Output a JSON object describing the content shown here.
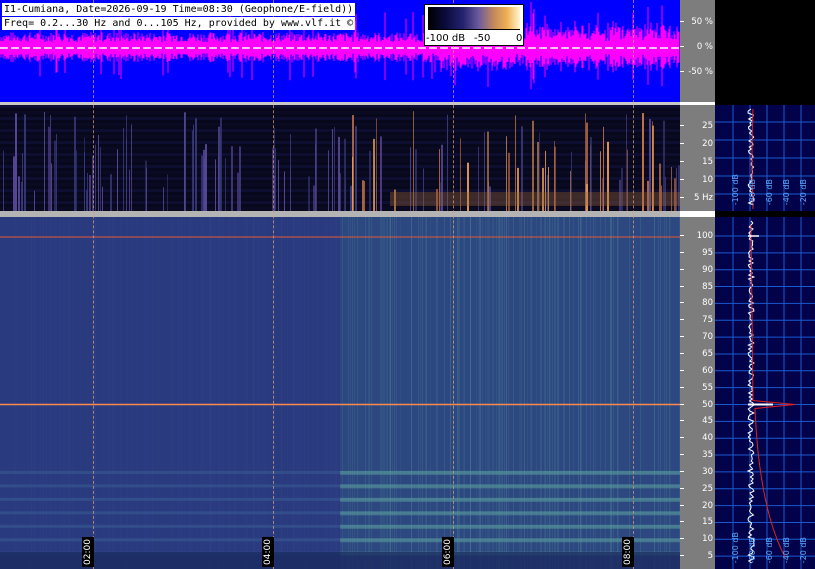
{
  "header": {
    "line1": "I1-Cumiana, Date=2026-09-19 Time=08:30 (Geophone/E-field))",
    "line2": "Freq= 0.2...30 Hz and 0...105 Hz, provided by www.vlf.it ©"
  },
  "colorbar": {
    "label_low": "-100 dB",
    "label_mid": "-50",
    "label_high": "0"
  },
  "waveform_scale": [
    "50 %",
    "0 %",
    "-50 %"
  ],
  "elf_scale": [
    "25",
    "20",
    "15",
    "10",
    "5 Hz"
  ],
  "main_scale": [
    "100",
    "95",
    "90",
    "85",
    "80",
    "75",
    "70",
    "65",
    "60",
    "55",
    "50",
    "45",
    "40",
    "35",
    "30",
    "25",
    "20",
    "15",
    "10",
    "5"
  ],
  "time_labels": [
    "02:00",
    "04:00",
    "06:00",
    "08:00"
  ],
  "side_labels_top": [
    "-100 dB",
    "-80 dB",
    "-60 dB",
    "-40 dB",
    "-20 dB"
  ],
  "side_labels_bottom": [
    "-100 dB",
    "-80 dB",
    "-60 dB",
    "-40 dB",
    "-20 dB"
  ],
  "colors": {
    "waveform_bg": "#0000ff",
    "waveform_trace": "#ff00ff",
    "spectrogram_bg": "#2a3a7e",
    "line_noise": "#e05a3a",
    "side_bg": "#02024a",
    "side_trace": "#ffffff",
    "side_curve": "#e02020"
  }
}
